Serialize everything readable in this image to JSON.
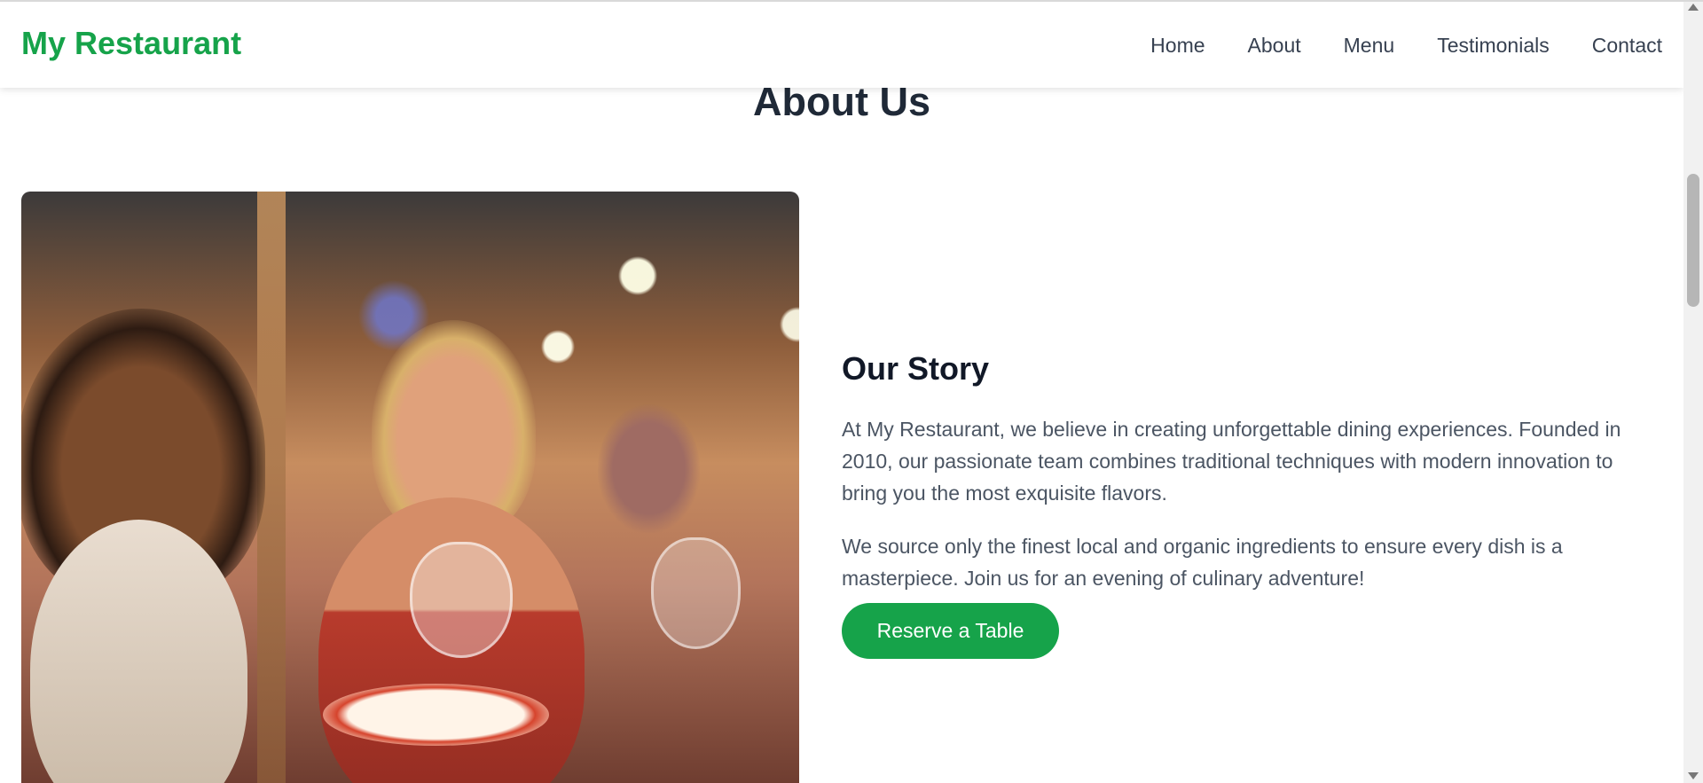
{
  "nav": {
    "brand": "My Restaurant",
    "links": [
      "Home",
      "About",
      "Menu",
      "Testimonials",
      "Contact"
    ]
  },
  "about": {
    "title": "About Us",
    "image_alt": "diners enjoying bruschetta and wine",
    "story_title": "Our Story",
    "paragraph1": "At My Restaurant, we believe in creating unforgettable dining experiences. Founded in 2010, our passionate team combines traditional techniques with modern innovation to bring you the most exquisite flavors.",
    "paragraph2": "We source only the finest local and organic ingredients to ensure every dish is a masterpiece. Join us for an evening of culinary adventure!",
    "button": "Reserve a Table"
  },
  "colors": {
    "accent": "#16a34a",
    "heading": "#1f2937",
    "body_text": "#4b5563"
  }
}
